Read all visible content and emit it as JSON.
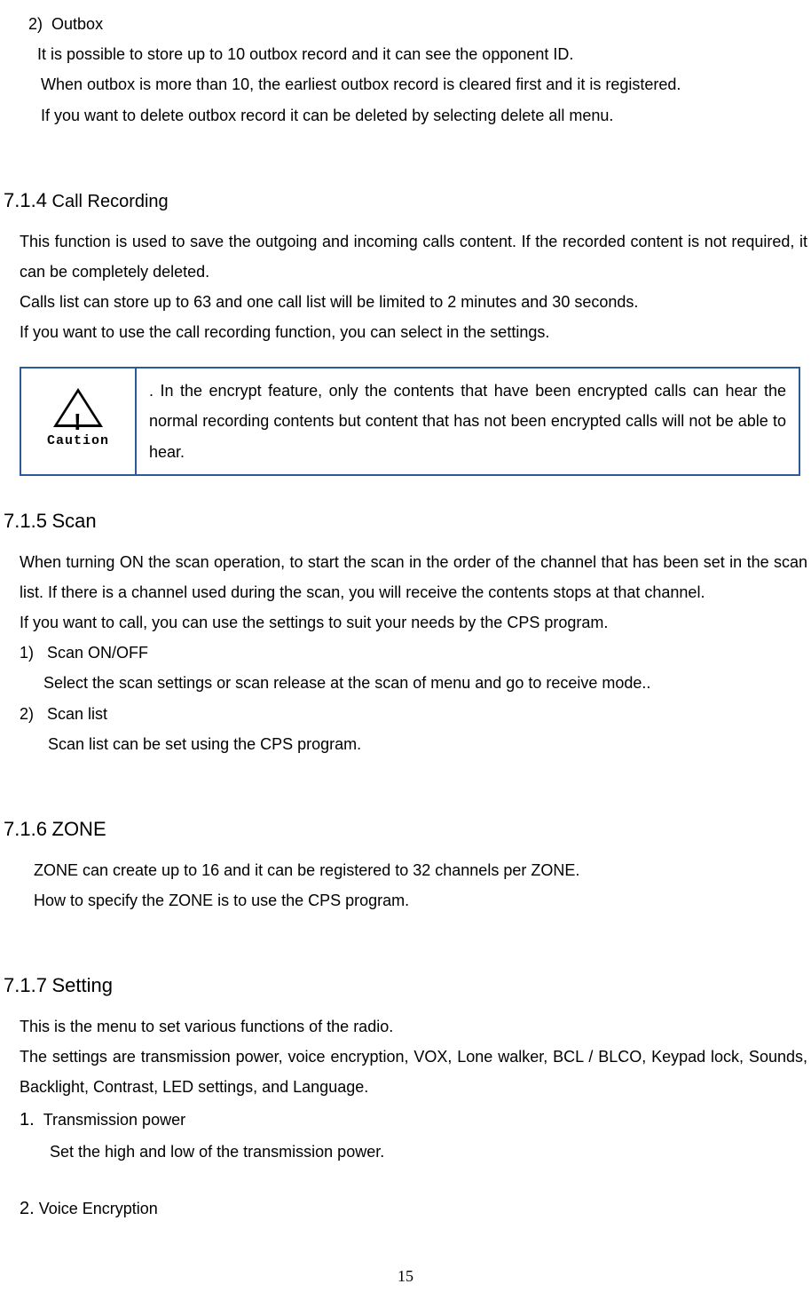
{
  "item2": {
    "number": "2)",
    "title": "Outbox",
    "line1": "It is possible to store up to 10 outbox record and it can see the opponent ID.",
    "line2": "When outbox is more than 10, the earliest outbox record is cleared first and it is registered.",
    "line3": "If you want to delete outbox record it can be deleted by selecting delete all menu."
  },
  "section714": {
    "heading_num": "7.1.4",
    "heading_text": "Call Recording",
    "p1": "This function is used to save the outgoing and incoming calls content. If the recorded content is not required, it can be completely deleted.",
    "p2": "Calls list can store up to 63 and one call list will be limited to 2 minutes and 30 seconds.",
    "p3": "If you want to use the call recording function, you can select in the settings."
  },
  "caution": {
    "label": "Caution",
    "text": ". In the encrypt feature, only the contents that have been encrypted calls can hear the normal recording contents but content that has not been encrypted calls will not be able to hear."
  },
  "section715": {
    "heading_num": "7.1.5",
    "heading_text": "Scan",
    "p1": "When turning ON the scan operation, to start the scan in the order of the channel that has been set in the scan list. If there is a channel used during the scan, you will receive the contents stops at that channel.",
    "p2": "If you want to call, you can use the settings to suit your needs by the CPS program.",
    "item1_num": "1)",
    "item1_title": "Scan ON/OFF",
    "item1_text": "Select the scan settings or scan release at the scan of menu and go to receive mode..",
    "item2_num": "2)",
    "item2_title": "Scan list",
    "item2_text": "Scan list can be set using the CPS program."
  },
  "section716": {
    "heading_num": "7.1.6",
    "heading_text": "ZONE",
    "p1": "ZONE can create up to 16 and it can be registered to 32 channels per ZONE.",
    "p2": "How to specify the ZONE is to use the CPS program."
  },
  "section717": {
    "heading_num": "7.1.7",
    "heading_text": "Setting",
    "p1": "This is the menu to set various functions of the radio.",
    "p2": "The settings are transmission power, voice encryption, VOX, Lone walker, BCL / BLCO, Keypad lock, Sounds, Backlight, Contrast, LED settings, and Language.",
    "item1_num": "1.",
    "item1_title": "Transmission power",
    "item1_text": "Set the high and low of the transmission power.",
    "item2_num": "2.",
    "item2_title": "Voice Encryption"
  },
  "page_num": "15"
}
